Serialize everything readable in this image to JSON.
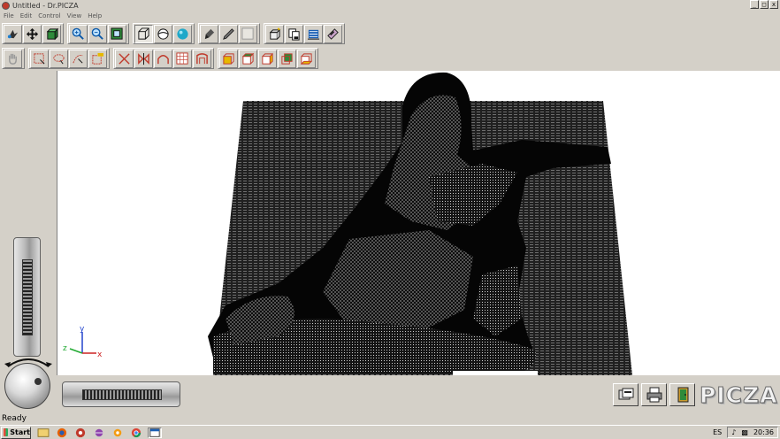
{
  "window": {
    "title": "Untitled - Dr.PICZA",
    "min_label": "_",
    "max_label": "□",
    "close_label": "x"
  },
  "menu": {
    "items": [
      "File",
      "Edit",
      "Control",
      "View",
      "Help"
    ]
  },
  "toolbar1": {
    "groups": [
      [
        {
          "name": "move-tool-icon",
          "pressed": false
        },
        {
          "name": "pan-arrows-icon",
          "pressed": false
        },
        {
          "name": "rotate-object-icon",
          "pressed": false
        }
      ],
      [
        {
          "name": "zoom-in-icon",
          "pressed": false
        },
        {
          "name": "zoom-out-icon",
          "pressed": false
        },
        {
          "name": "zoom-fit-icon",
          "pressed": false
        }
      ],
      [
        {
          "name": "wireframe-view-icon",
          "pressed": true
        },
        {
          "name": "flat-shade-icon",
          "pressed": false
        },
        {
          "name": "smooth-shade-icon",
          "pressed": false
        }
      ],
      [
        {
          "name": "paint-brush-icon",
          "pressed": false
        },
        {
          "name": "pencil-icon",
          "pressed": false
        },
        {
          "name": "blank-icon",
          "pressed": false
        }
      ],
      [
        {
          "name": "cube-light-icon",
          "pressed": false
        },
        {
          "name": "documents-icon",
          "pressed": false
        },
        {
          "name": "scan-icon",
          "pressed": false
        },
        {
          "name": "film-strip-icon",
          "pressed": false
        }
      ]
    ]
  },
  "toolbar2": {
    "groups": [
      [
        {
          "name": "hand-icon",
          "pressed": false
        }
      ],
      [
        {
          "name": "rect-select-icon",
          "pressed": false
        },
        {
          "name": "lasso-select-icon",
          "pressed": false
        },
        {
          "name": "select-clear-icon",
          "pressed": false
        },
        {
          "name": "select-all-icon",
          "pressed": false
        }
      ],
      [
        {
          "name": "trim-icon",
          "pressed": false
        },
        {
          "name": "mirror-icon",
          "pressed": false
        },
        {
          "name": "arch-icon",
          "pressed": false
        },
        {
          "name": "grid-icon",
          "pressed": false
        },
        {
          "name": "frame-icon",
          "pressed": false
        }
      ],
      [
        {
          "name": "box-front-icon",
          "pressed": false
        },
        {
          "name": "box-top-icon",
          "pressed": false
        },
        {
          "name": "box-side-icon",
          "pressed": false
        },
        {
          "name": "box-back-icon",
          "pressed": false
        },
        {
          "name": "box-bottom-icon",
          "pressed": false
        }
      ]
    ]
  },
  "axes": {
    "x": "x",
    "y": "y",
    "z": "z"
  },
  "bottom_buttons": [
    {
      "name": "export-icon"
    },
    {
      "name": "print-icon"
    },
    {
      "name": "exit-door-icon"
    }
  ],
  "logo": {
    "text": "PICZA"
  },
  "status": {
    "text": "Ready"
  },
  "taskbar": {
    "start_label": "Start",
    "quick_icons": [
      "explorer-icon",
      "firefox-icon",
      "app-red-icon",
      "app-ball-icon",
      "app-orange-icon",
      "chrome-icon",
      "app-window-icon"
    ],
    "language": "ES",
    "time": "20:36"
  },
  "colors": {
    "window_bg": "#d4d0c8",
    "viewport_bg": "#ffffff",
    "mesh": "#1a1a1a"
  }
}
